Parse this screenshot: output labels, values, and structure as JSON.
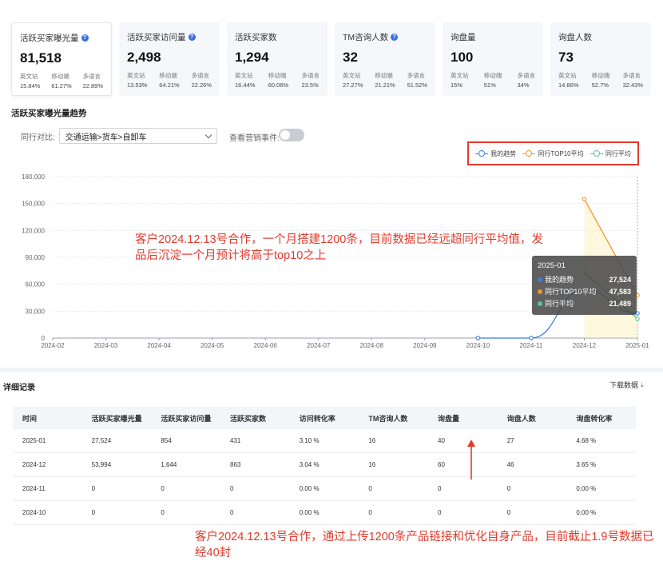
{
  "cards": [
    {
      "title": "活跃买家曝光量",
      "info": true,
      "value": "81,518",
      "subs": [
        {
          "label": "英文站",
          "pct": "15.84%"
        },
        {
          "label": "移动端",
          "pct": "61.27%"
        },
        {
          "label": "多语言",
          "pct": "22.89%"
        }
      ]
    },
    {
      "title": "活跃买家访问量",
      "info": true,
      "value": "2,498",
      "subs": [
        {
          "label": "英文站",
          "pct": "13.53%"
        },
        {
          "label": "移动端",
          "pct": "64.21%"
        },
        {
          "label": "多语言",
          "pct": "22.26%"
        }
      ]
    },
    {
      "title": "活跃买家数",
      "info": false,
      "value": "1,294",
      "subs": [
        {
          "label": "英文站",
          "pct": "16.44%"
        },
        {
          "label": "移动端",
          "pct": "60.06%"
        },
        {
          "label": "多语言",
          "pct": "23.5%"
        }
      ]
    },
    {
      "title": "TM咨询人数",
      "info": true,
      "value": "32",
      "subs": [
        {
          "label": "英文站",
          "pct": "27.27%"
        },
        {
          "label": "移动端",
          "pct": "21.21%"
        },
        {
          "label": "多语言",
          "pct": "51.52%"
        }
      ]
    },
    {
      "title": "询盘量",
      "info": false,
      "value": "100",
      "subs": [
        {
          "label": "英文站",
          "pct": "15%"
        },
        {
          "label": "移动端",
          "pct": "51%"
        },
        {
          "label": "多语言",
          "pct": "34%"
        }
      ]
    },
    {
      "title": "询盘人数",
      "info": false,
      "value": "73",
      "subs": [
        {
          "label": "英文站",
          "pct": "14.86%"
        },
        {
          "label": "移动端",
          "pct": "52.7%"
        },
        {
          "label": "多语言",
          "pct": "32.43%"
        }
      ]
    }
  ],
  "trend": {
    "section_title": "活跃买家曝光量趋势",
    "compare_label": "同行对比:",
    "compare_value": "交通运输>货车>自卸车",
    "event_label": "查看营销事件:"
  },
  "chart_data": {
    "type": "line",
    "x": [
      "2024-02",
      "2024-03",
      "2024-04",
      "2024-05",
      "2024-06",
      "2024-07",
      "2024-08",
      "2024-09",
      "2024-10",
      "2024-11",
      "2024-12",
      "2025-01"
    ],
    "yticks": [
      "0",
      "30,000",
      "60,000",
      "90,000",
      "120,000",
      "150,000",
      "180,000"
    ],
    "ylim": [
      0,
      180000
    ],
    "series": [
      {
        "name": "我的趋势",
        "color": "#3d7de0",
        "values": [
          null,
          null,
          null,
          null,
          null,
          null,
          null,
          null,
          0,
          0,
          53994,
          27524
        ]
      },
      {
        "name": "同行TOP10平均",
        "color": "#f0952e",
        "values": [
          null,
          null,
          null,
          null,
          null,
          null,
          null,
          null,
          null,
          null,
          155000,
          47583
        ]
      },
      {
        "name": "同行平均",
        "color": "#4fc99a",
        "values": [
          null,
          null,
          null,
          null,
          null,
          null,
          null,
          null,
          null,
          null,
          73000,
          21489
        ]
      }
    ],
    "legend": "top-right"
  },
  "tooltip": {
    "title": "2025-01",
    "rows": [
      {
        "name": "我的趋势",
        "value": "27,524",
        "color": "#3d7de0"
      },
      {
        "name": "同行TOP10平均",
        "value": "47,583",
        "color": "#f0952e"
      },
      {
        "name": "同行平均",
        "value": "21,489",
        "color": "#4fc99a"
      }
    ]
  },
  "annotations": {
    "chart_note": "客户2024.12.13号合作，一个月搭建1200条，目前数据已经远超同行平均值，发品后沉淀一个月预计将高于top10之上",
    "table_note": "客户2024.12.13号合作，通过上传1200条产品链接和优化自身产品，目前截止1.9号数据已经40封"
  },
  "detail": {
    "title": "详细记录",
    "download_label": "下载数据",
    "columns": [
      "时间",
      "活跃买家曝光量",
      "活跃买家访问量",
      "活跃买家数",
      "访问转化率",
      "TM咨询人数",
      "询盘量",
      "询盘人数",
      "询盘转化率"
    ],
    "rows": [
      [
        "2025-01",
        "27,524",
        "854",
        "431",
        "3.10 %",
        "16",
        "40",
        "27",
        "4.68 %"
      ],
      [
        "2024-12",
        "53,994",
        "1,644",
        "863",
        "3.04 %",
        "16",
        "60",
        "46",
        "3.65 %"
      ],
      [
        "2024-11",
        "0",
        "0",
        "0",
        "0.00 %",
        "0",
        "0",
        "0",
        "0.00 %"
      ],
      [
        "2024-10",
        "0",
        "0",
        "0",
        "0.00 %",
        "0",
        "0",
        "0",
        "0.00 %"
      ]
    ]
  }
}
